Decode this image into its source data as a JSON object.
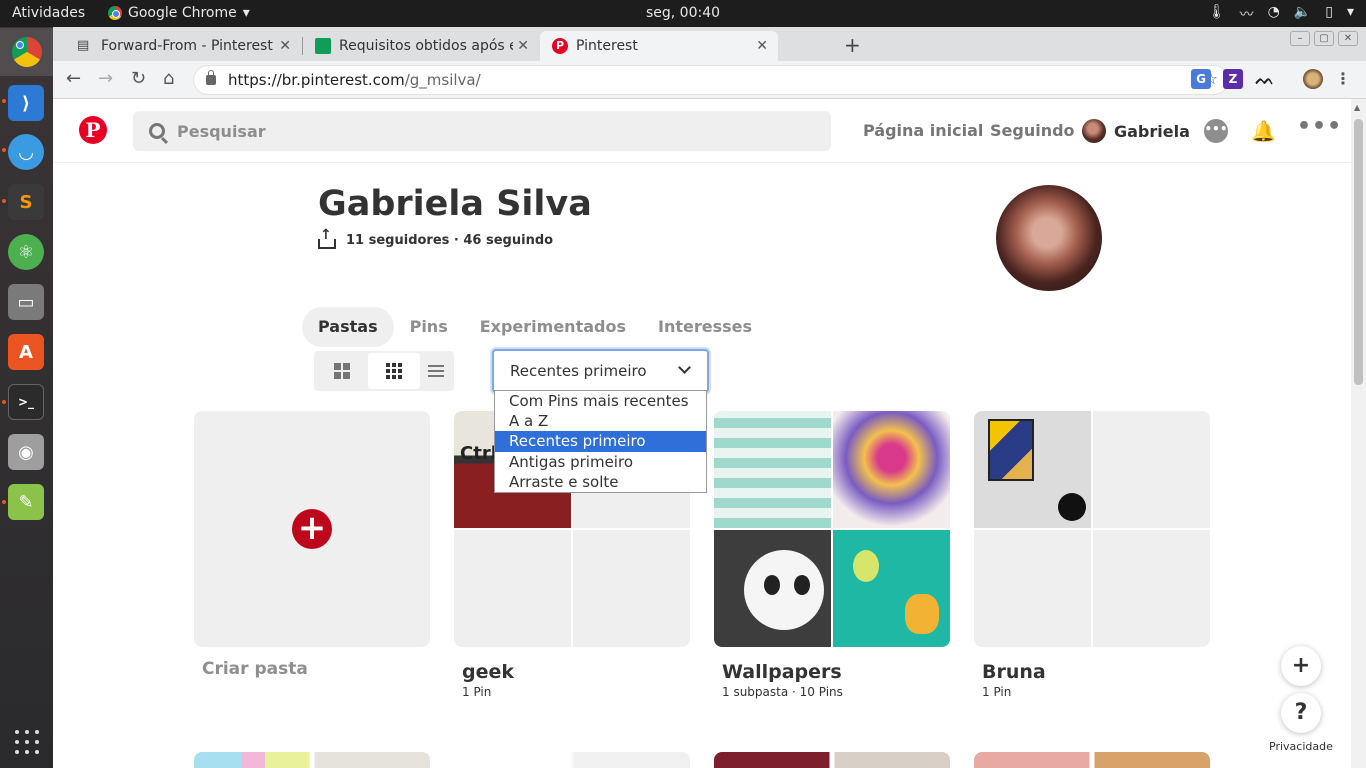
{
  "topbar": {
    "activities": "Atividades",
    "app_name": "Google Chrome",
    "clock": "seg, 00:40"
  },
  "launcher": {
    "apps": [
      "chrome",
      "vscode",
      "robo",
      "sublime",
      "atom",
      "files",
      "software-center",
      "terminal",
      "camera",
      "screenshot-tool"
    ]
  },
  "browser": {
    "tabs": [
      {
        "title": "Forward-From - Pinterest",
        "icon": "doc-icon"
      },
      {
        "title": "Requisitos obtidos após e",
        "icon": "sheets-icon"
      },
      {
        "title": "Pinterest",
        "icon": "pinterest-icon",
        "active": true
      }
    ],
    "url_host": "https://br.pinterest.com",
    "url_path": "/g_msilva/"
  },
  "header": {
    "search_placeholder": "Pesquisar",
    "home": "Página inicial",
    "following": "Seguindo",
    "user": "Gabriela"
  },
  "profile": {
    "name": "Gabriela Silva",
    "stats": "11 seguidores · 46 seguindo"
  },
  "profile_tabs": [
    "Pastas",
    "Pins",
    "Experimentados",
    "Interesses"
  ],
  "sort": {
    "selected": "Recentes primeiro",
    "options": [
      "Com Pins mais recentes",
      "A a Z",
      "Recentes primeiro",
      "Antigas primeiro",
      "Arraste e solte"
    ]
  },
  "boards": [
    {
      "title": "Criar pasta",
      "meta": ""
    },
    {
      "title": "geek",
      "meta": "1 Pin",
      "cover_text": "Ctrl"
    },
    {
      "title": "Wallpapers",
      "meta": "1 subpasta · 10 Pins"
    },
    {
      "title": "Bruna",
      "meta": "1 Pin"
    }
  ],
  "floating": {
    "add": "+",
    "help": "?",
    "privacy": "Privacidade"
  },
  "colors": {
    "pinterest_red": "#e60023",
    "select_highlight": "#2f6fd9"
  }
}
